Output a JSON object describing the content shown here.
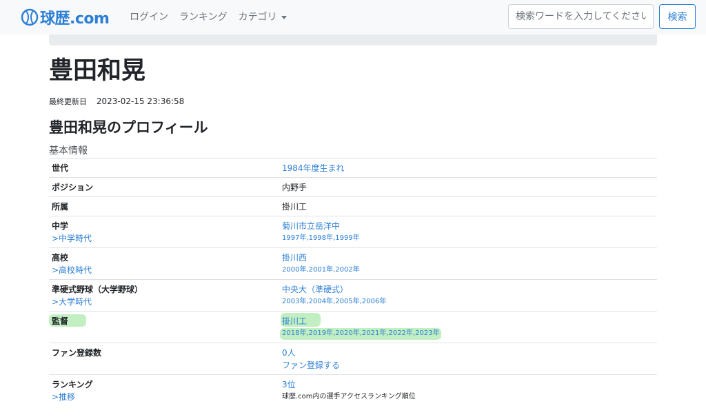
{
  "brand": {
    "name": "球歴.com"
  },
  "nav": {
    "login": "ログイン",
    "ranking": "ランキング",
    "category": "カテゴリ"
  },
  "search": {
    "placeholder": "検索ワードを入力してください",
    "button": "検索"
  },
  "page": {
    "title": "豊田和晃",
    "updated_label": "最終更新日",
    "updated_value": "2023-02-15 23:36:58",
    "section_title": "豊田和晃のプロフィール",
    "table_caption": "基本情報"
  },
  "rows": [
    {
      "head": "世代",
      "value": "1984年度生まれ"
    },
    {
      "head": "ポジション",
      "value": "内野手"
    },
    {
      "head": "所属",
      "value": "掛川工"
    },
    {
      "head": "中学",
      "sub": ">中学時代",
      "value": "菊川市立岳洋中",
      "years": "1997年,1998年,1999年"
    },
    {
      "head": "高校",
      "sub": ">高校時代",
      "value": "掛川西",
      "years": "2000年,2001年,2002年"
    },
    {
      "head": "準硬式野球（大学野球）",
      "sub": ">大学時代",
      "value": "中央大（準硬式）",
      "years": "2003年,2004年,2005年,2006年"
    },
    {
      "head": "監督",
      "value": "掛川工",
      "years": "2018年,2019年,2020年,2021年,2022年,2023年"
    },
    {
      "head": "ファン登録数",
      "value": "0人",
      "action": "ファン登録する"
    },
    {
      "head": "ランキング",
      "sub": ">推移",
      "value": "3位",
      "note": "球歴.com内の選手アクセスランキング順位"
    }
  ]
}
